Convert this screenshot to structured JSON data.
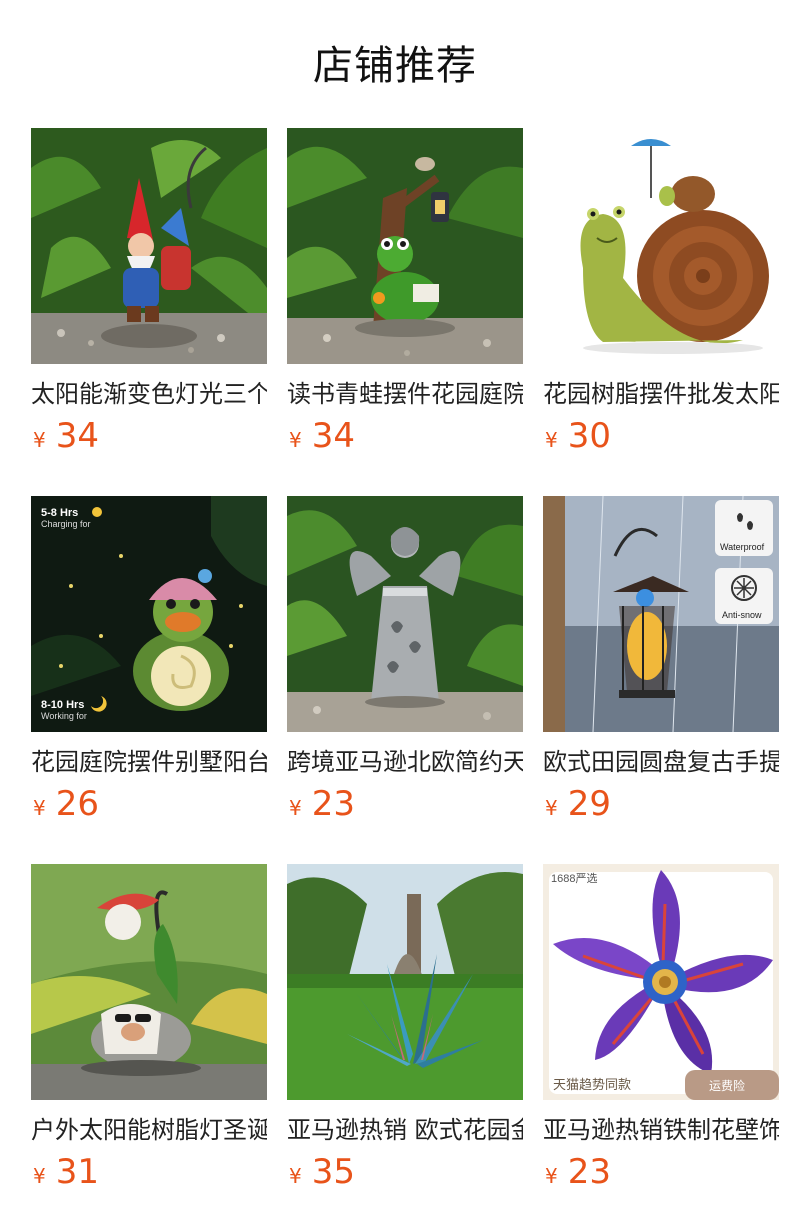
{
  "header": {
    "title": "店铺推荐"
  },
  "currency_symbol": "¥",
  "products": [
    {
      "name": "太阳能渐变色灯光三个小矮人花园摆件",
      "price": "34",
      "image": "gnome-statue-in-ferns"
    },
    {
      "name": "读书青蛙摆件花园庭院太阳能灯",
      "price": "34",
      "image": "frog-reading-under-tree-with-lantern"
    },
    {
      "name": "花园树脂摆件批发太阳能蜗牛",
      "price": "30",
      "image": "snail-with-umbrella"
    },
    {
      "name": "花园庭院摆件别墅阳台太阳能青蛙灯",
      "price": "26",
      "image": "frog-with-solar-light-at-night",
      "overlay_texts": [
        "5-8 Hrs",
        "Charging for",
        "8-10 Hrs",
        "Working for"
      ]
    },
    {
      "name": "跨境亚马逊北欧简约天使雕像",
      "price": "23",
      "image": "angel-statue-in-garden"
    },
    {
      "name": "欧式田园圆盘复古手提太阳能灯",
      "price": "29",
      "image": "hanging-solar-lantern-in-rain",
      "overlay_texts": [
        "Waterproof",
        "Anti-snow"
      ]
    },
    {
      "name": "户外太阳能树脂灯圣诞小矮人",
      "price": "31",
      "image": "gnome-with-flower-lamp"
    },
    {
      "name": "亚马逊热销 欧式花园金属龙舌兰",
      "price": "35",
      "image": "metal-agave-on-lawn"
    },
    {
      "name": "亚马逊热销铁制花壁饰",
      "price": "23",
      "image": "purple-metal-flower",
      "overlay_texts": [
        "1688严选",
        "天猫趋势同款",
        "运费险"
      ]
    }
  ]
}
